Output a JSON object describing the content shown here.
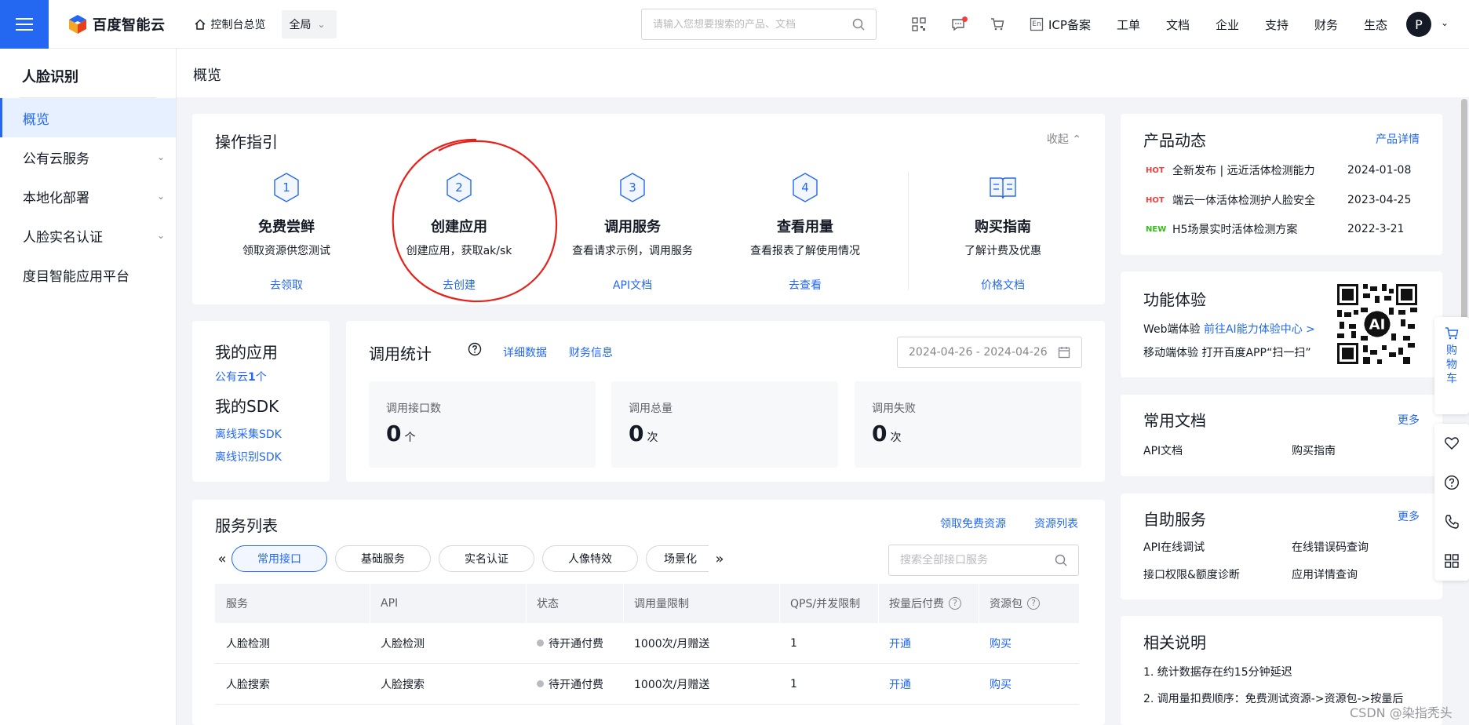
{
  "topbar": {
    "brand": "百度智能云",
    "console": "控制台总览",
    "region": "全局",
    "search_placeholder": "请输入您想要搜索的产品、文档",
    "icons": [
      "qrcode-icon",
      "message-icon",
      "cart-icon",
      "language-icon"
    ],
    "language_label": "En",
    "nav": [
      "ICP备案",
      "工单",
      "文档",
      "企业",
      "支持",
      "财务",
      "生态"
    ],
    "avatar_initial": "P"
  },
  "sidebar": {
    "title": "人脸识别",
    "items": [
      {
        "label": "概览",
        "active": true,
        "expandable": false
      },
      {
        "label": "公有云服务",
        "active": false,
        "expandable": true
      },
      {
        "label": "本地化部署",
        "active": false,
        "expandable": true
      },
      {
        "label": "人脸实名认证",
        "active": false,
        "expandable": true
      },
      {
        "label": "度目智能应用平台",
        "active": false,
        "expandable": false
      }
    ]
  },
  "page": {
    "title": "概览"
  },
  "guide": {
    "title": "操作指引",
    "collapse_label": "收起",
    "steps": [
      {
        "num": "1",
        "title": "免费尝鲜",
        "desc": "领取资源供您测试",
        "link": "去领取"
      },
      {
        "num": "2",
        "title": "创建应用",
        "desc": "创建应用，获取ak/sk",
        "link": "去创建"
      },
      {
        "num": "3",
        "title": "调用服务",
        "desc": "查看请求示例，调用服务",
        "link": "API文档"
      },
      {
        "num": "4",
        "title": "查看用量",
        "desc": "查看报表了解使用情况",
        "link": "去查看"
      }
    ],
    "buy": {
      "title": "购买指南",
      "desc": "了解计费及优惠",
      "link": "价格文档"
    }
  },
  "my_app": {
    "apps_title": "我的应用",
    "apps_prefix": "公有云",
    "apps_count": "1",
    "apps_suffix": "个",
    "sdk_title": "我的SDK",
    "sdk_links": [
      "离线采集SDK",
      "离线识别SDK"
    ]
  },
  "stats": {
    "title": "调用统计",
    "links": [
      "详细数据",
      "财务信息"
    ],
    "date_range": "2024-04-26 - 2024-04-26",
    "boxes": [
      {
        "label": "调用接口数",
        "value": "0",
        "unit": "个"
      },
      {
        "label": "调用总量",
        "value": "0",
        "unit": "次"
      },
      {
        "label": "调用失败",
        "value": "0",
        "unit": "次"
      }
    ]
  },
  "services": {
    "title": "服务列表",
    "links": [
      "领取免费资源",
      "资源列表"
    ],
    "tabs": [
      "常用接口",
      "基础服务",
      "实名认证",
      "人像特效",
      "场景化"
    ],
    "search_placeholder": "搜索全部接口服务",
    "columns": [
      "服务",
      "API",
      "状态",
      "调用量限制",
      "QPS/并发限制",
      "按量后付费",
      "资源包"
    ],
    "rows": [
      {
        "service": "人脸检测",
        "api": "人脸检测",
        "status": "待开通付费",
        "limit": "1000次/月赠送",
        "qps": "1",
        "postpaid": "开通",
        "package": "购买"
      },
      {
        "service": "人脸搜索",
        "api": "人脸搜索",
        "status": "待开通付费",
        "limit": "1000次/月赠送",
        "qps": "1",
        "postpaid": "开通",
        "package": "购买"
      }
    ]
  },
  "news": {
    "title": "产品动态",
    "more": "产品详情",
    "items": [
      {
        "tag": "HOT",
        "title": "全新发布 | 远近活体检测能力",
        "date": "2024-01-08"
      },
      {
        "tag": "HOT",
        "title": "端云一体活体检测护人脸安全",
        "date": "2023-04-25"
      },
      {
        "tag": "NEW",
        "title": "H5场景实时活体检测方案",
        "date": "2022-3-21"
      }
    ]
  },
  "feature": {
    "title": "功能体验",
    "web_label": "Web端体验",
    "web_link": "前往AI能力体验中心 >",
    "mobile_text": "移动端体验 打开百度APP“扫一扫”",
    "qr_badge": "AI"
  },
  "docs": {
    "title": "常用文档",
    "more": "更多",
    "links": [
      "API文档",
      "购买指南"
    ]
  },
  "self_service": {
    "title": "自助服务",
    "more": "更多",
    "links": [
      "API在线调试",
      "在线错误码查询",
      "接口权限&额度诊断",
      "应用详情查询"
    ]
  },
  "notes": {
    "title": "相关说明",
    "items": [
      "1. 统计数据存在约15分钟延迟",
      "2. 调用量扣费顺序：免费测试资源->资源包->按量后"
    ]
  },
  "float_bar": {
    "cart_label": "购物车",
    "icons": [
      "favorite-icon",
      "help-icon",
      "phone-icon",
      "apps-icon"
    ]
  },
  "watermark": "CSDN @染指秃头",
  "colors": {
    "accent": "#2468f2",
    "annotation": "#e8201a",
    "hot": "#f33e3e",
    "new": "#30bf13"
  }
}
